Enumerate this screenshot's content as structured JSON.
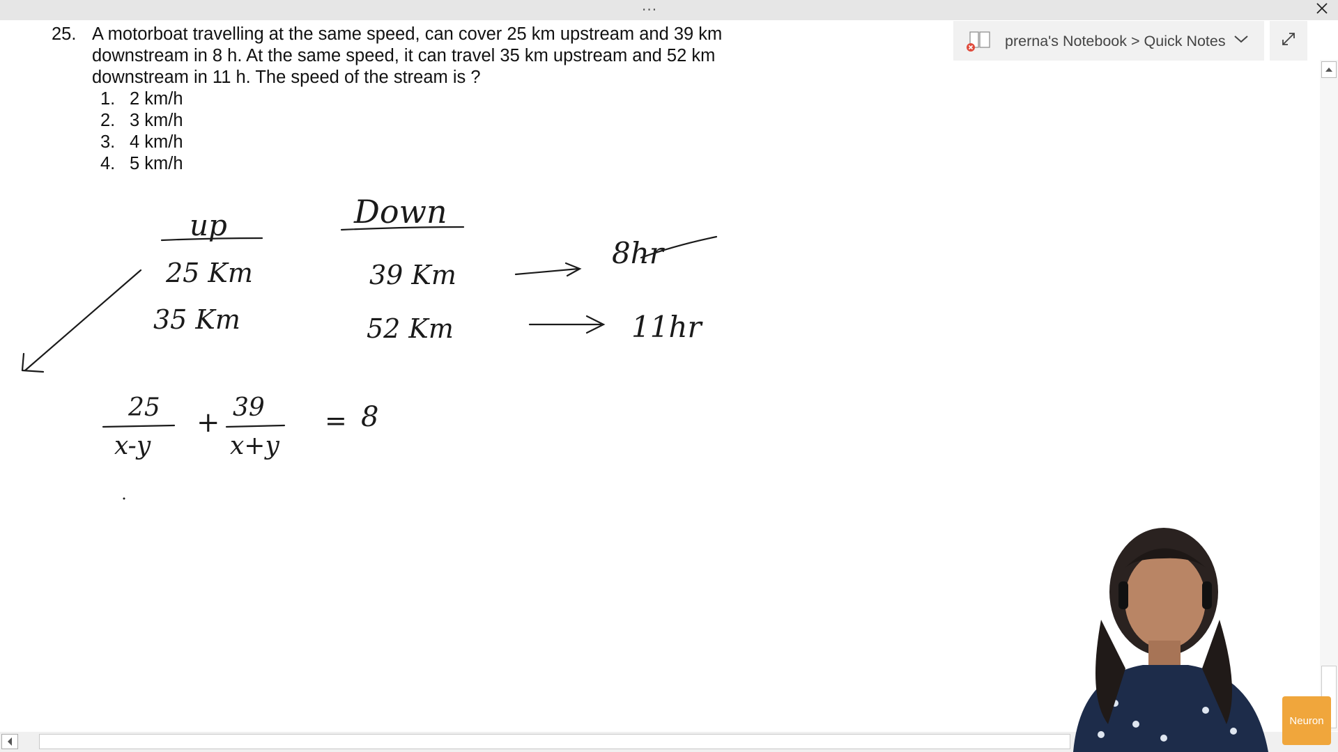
{
  "window": {
    "drag_handle": "···",
    "close_symbol": "✕"
  },
  "question": {
    "number": "25.",
    "lines": [
      "A motorboat travelling at the same speed, can cover 25 km upstream and 39 km",
      "downstream in 8 h. At the same speed, it can travel 35 km upstream and 52 km",
      "downstream in 11 h. The speed of the stream is ?"
    ],
    "options": [
      {
        "num": "1.",
        "text": "2 km/h"
      },
      {
        "num": "2.",
        "text": "3 km/h"
      },
      {
        "num": "3.",
        "text": "4 km/h"
      },
      {
        "num": "4.",
        "text": "5 km/h"
      }
    ]
  },
  "notebook": {
    "breadcrumb": "prerna's Notebook > Quick Notes",
    "icon": "notebook-sync-error-icon",
    "chevron": "chevron-down-icon",
    "expand_icon": "expand-icon"
  },
  "handwriting": {
    "col_up": "up",
    "col_down": "Down",
    "up_1": "25 Km",
    "up_2": "35 Km",
    "down_1": "39 Km",
    "down_2": "52 Km",
    "time_1": "8hr",
    "time_2": "11hr",
    "eq_num1": "25",
    "eq_den1": "x-y",
    "eq_plus": "+",
    "eq_num2": "39",
    "eq_den2": "x+y",
    "eq_equals": "=",
    "eq_rhs": "8"
  },
  "logo": {
    "text": "Neuron"
  },
  "colors": {
    "titlebar": "#e6e6e6",
    "ink": "#1a1a1a",
    "logo_bg": "#f0a63c"
  }
}
